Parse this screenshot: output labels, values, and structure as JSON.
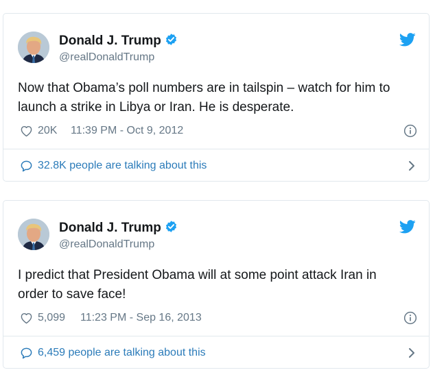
{
  "colors": {
    "verified_blue": "#1da1f2",
    "twitter_blue": "#1da1f2",
    "link_blue": "#2b7bb9",
    "muted_gray": "#657786",
    "border": "#e1e8ed"
  },
  "icons": {
    "verified": "verified-badge-icon",
    "bird": "twitter-bird-icon",
    "heart": "heart-icon",
    "info": "info-icon",
    "bubble": "speech-bubble-icon",
    "chevron": "chevron-right-icon"
  },
  "tweets": [
    {
      "author_name": "Donald J. Trump",
      "handle": "@realDonaldTrump",
      "text_line1": "Now that Obama’s poll numbers are in tailspin – watch for him to",
      "text_line2": "launch a strike in Libya or Iran.  He is desperate.",
      "likes": "20K",
      "timestamp": "11:39 PM - Oct 9, 2012",
      "talking": "32.8K people are talking about this"
    },
    {
      "author_name": "Donald J. Trump",
      "handle": "@realDonaldTrump",
      "text_line1": "I predict that President Obama will at some point attack Iran in",
      "text_line2": "order to save face!",
      "likes": "5,099",
      "timestamp": "11:23 PM - Sep 16, 2013",
      "talking": "6,459 people are talking about this"
    }
  ]
}
